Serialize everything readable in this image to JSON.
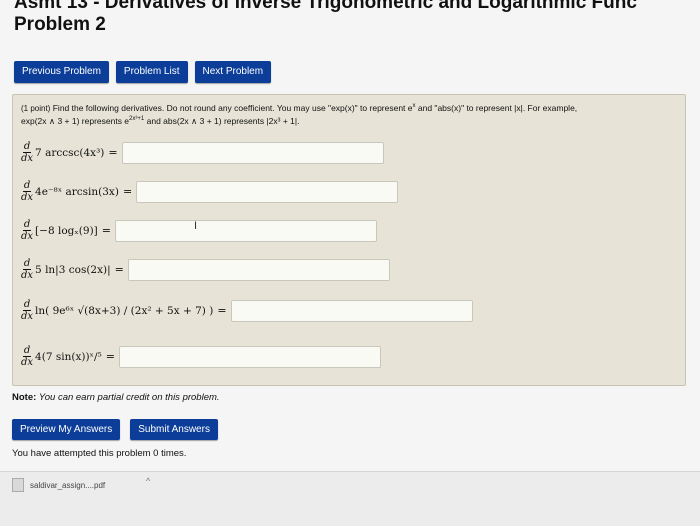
{
  "page": {
    "title_line1": "Asmt 13 - Derivatives of Inverse Trigonometric and Logarithmic Func",
    "title_line2": "Problem 2"
  },
  "nav": {
    "previous": "Previous Problem",
    "list": "Problem List",
    "next": "Next Problem"
  },
  "problem": {
    "points": "(1 point)",
    "intro_a": "Find the following derivatives. Do not round any coefficient. You may use \"exp(x)\" to represent e",
    "intro_sup": "x",
    "intro_b": "and \"abs(x)\" to represent |x|. For example,",
    "intro_line2a": "exp(2x ∧ 3 + 1) represents e",
    "intro_line2sup": "2x³+1",
    "intro_line2b": "and abs(2x ∧ 3 + 1) represents |2x³ + 1|.",
    "d": "d",
    "dx": "dx",
    "equals": "=",
    "items": [
      {
        "expr": "7 arccsc(4x³)",
        "answer": ""
      },
      {
        "expr": "4e⁻⁸ˣ arcsin(3x)",
        "answer": ""
      },
      {
        "expr": "[−8 logₓ(9)]",
        "answer": ""
      },
      {
        "expr": "5 ln|3 cos(2x)|",
        "answer": ""
      },
      {
        "expr": "ln( 9e⁶ˣ √(8x+3) / (2x² + 5x + 7) )",
        "answer": ""
      },
      {
        "expr": "4(7 sin(x))ˣ/⁵",
        "answer": ""
      }
    ]
  },
  "note": {
    "label": "Note:",
    "text": "You can earn partial credit on this problem."
  },
  "actions": {
    "preview": "Preview My Answers",
    "submit": "Submit Answers"
  },
  "attempts": "You have attempted this problem 0 times.",
  "download": {
    "filename": "saldivar_assign....pdf"
  }
}
